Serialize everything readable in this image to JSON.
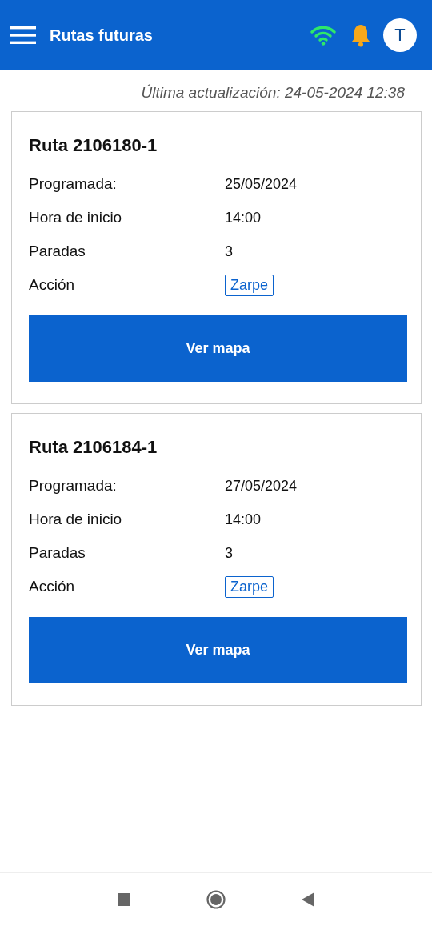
{
  "app_bar": {
    "title": "Rutas futuras",
    "avatar_initial": "T"
  },
  "last_update": "Última actualización: 24-05-2024 12:38",
  "routes": [
    {
      "title": "Ruta 2106180-1",
      "fields": [
        {
          "label": "Programada:",
          "value": "25/05/2024",
          "kind": "text"
        },
        {
          "label": "Hora de inicio",
          "value": "14:00",
          "kind": "text"
        },
        {
          "label": "Paradas",
          "value": "3",
          "kind": "text"
        },
        {
          "label": "Acción",
          "value": "Zarpe",
          "kind": "tag"
        }
      ],
      "button": "Ver mapa"
    },
    {
      "title": "Ruta 2106184-1",
      "fields": [
        {
          "label": "Programada:",
          "value": "27/05/2024",
          "kind": "text"
        },
        {
          "label": "Hora de inicio",
          "value": "14:00",
          "kind": "text"
        },
        {
          "label": "Paradas",
          "value": "3",
          "kind": "text"
        },
        {
          "label": "Acción",
          "value": "Zarpe",
          "kind": "tag"
        }
      ],
      "button": "Ver mapa"
    }
  ]
}
